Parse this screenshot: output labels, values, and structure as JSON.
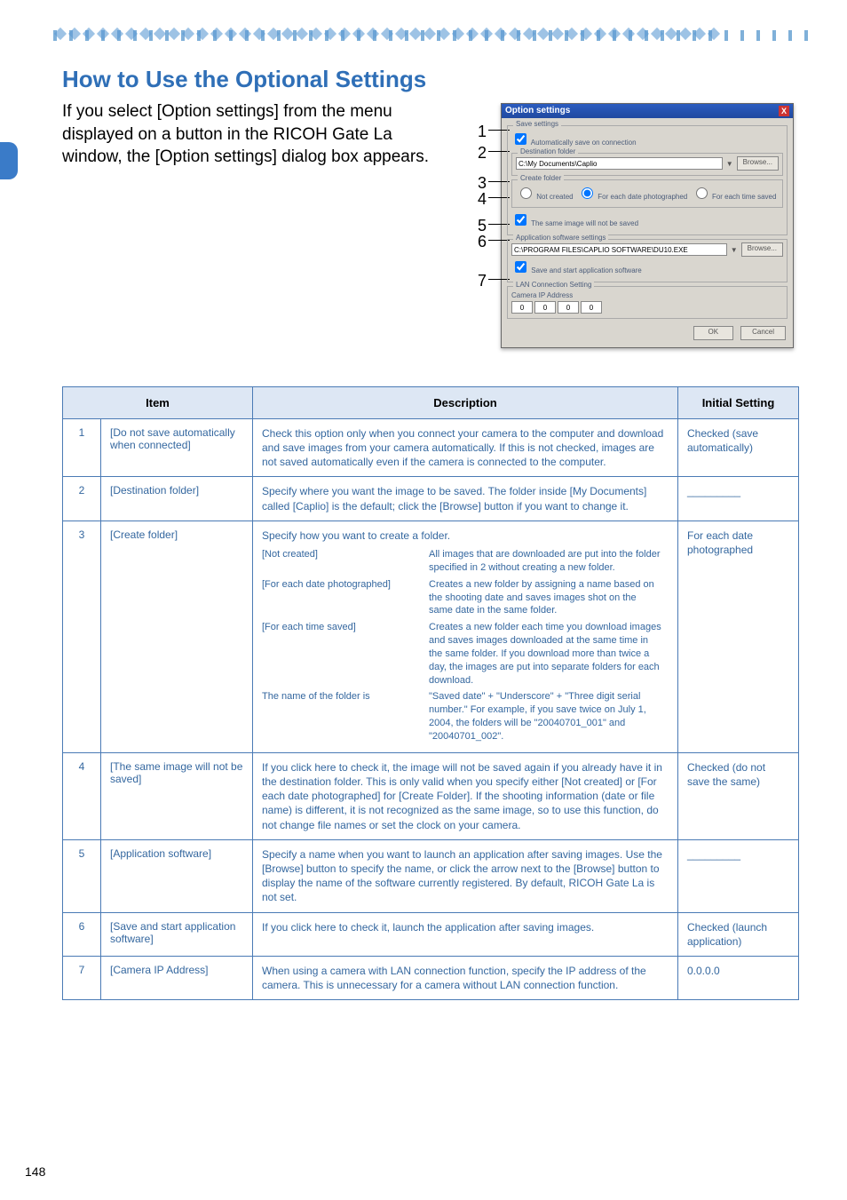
{
  "page_number": "148",
  "heading": "How to Use the Optional Settings",
  "intro": "If you select [Option settings] from the menu displayed on a button in the RICOH Gate La window, the [Option settings] dialog box appears.",
  "callouts": [
    "1",
    "2",
    "3",
    "4",
    "5",
    "6",
    "7"
  ],
  "dialog": {
    "title": "Option settings",
    "close": "X",
    "save_settings_label": "Save settings",
    "auto_save": "Automatically save on connection",
    "destination_label": "Destination folder",
    "destination_value": "C:\\My Documents\\Caplio",
    "browse": "Browse...",
    "create_folder_label": "Create folder",
    "cf_not_created": "Not created",
    "cf_each_date": "For each date photographed",
    "cf_each_time": "For each time saved",
    "same_image_not_saved": "The same image will not be saved",
    "app_settings_label": "Application software settings",
    "app_value": "C:\\PROGRAM FILES\\CAPLIO SOFTWARE\\DU10.EXE",
    "save_and_start": "Save and start application software",
    "lan_label": "LAN Connection Setting",
    "camera_ip_label": "Camera IP Address",
    "ip": [
      "0",
      "0",
      "0",
      "0"
    ],
    "ok": "OK",
    "cancel": "Cancel"
  },
  "table": {
    "head_item": "Item",
    "head_desc": "Description",
    "head_init": "Initial Setting",
    "rows": [
      {
        "n": "1",
        "item": "[Do not save automatically when connected]",
        "desc": "Check this option only when you connect your camera to the computer and download and save images from your camera automatically. If this is not checked, images are not saved automatically even if the camera is connected to the computer.",
        "init": "Checked (save automatically)"
      },
      {
        "n": "2",
        "item": "[Destination folder]",
        "desc": "Specify where you want the image to be saved. The folder inside [My Documents] called [Caplio] is the default; click the [Browse] button if you want to change it.",
        "init": "_________"
      },
      {
        "n": "3",
        "item": "[Create folder]",
        "desc_intro": "Specify how you want to create a folder.",
        "subrows": [
          {
            "k": "[Not created]",
            "v": "All images that are downloaded are put into the folder specified in 2 without creating a new folder."
          },
          {
            "k": "[For each date photographed]",
            "v": "Creates a new folder by assigning a name based on the shooting date and saves images shot on the same date in the same folder."
          },
          {
            "k": "[For each time saved]",
            "v": "Creates a new folder each time you download images and saves images downloaded at the same time in the same folder. If you download more than twice a day, the images are put into separate folders for each download."
          },
          {
            "k": "The name of the folder is",
            "v": "\"Saved date\" + \"Underscore\" + \"Three digit serial number.\" For example, if you save twice on July 1, 2004, the folders will be \"20040701_001\" and \"20040701_002\"."
          }
        ],
        "init": "For each date photographed"
      },
      {
        "n": "4",
        "item": "[The same image will not be saved]",
        "desc": "If you click here to check it, the image will not be saved again if you already have it in the destination folder. This is only valid when you specify either [Not created] or [For each date photographed] for [Create Folder]. If the shooting information (date or file name) is different, it is not recognized as the same image, so to use this function, do not change file names or set the clock on your camera.",
        "init": "Checked (do not save the same)"
      },
      {
        "n": "5",
        "item": "[Application software]",
        "desc": "Specify a name when you want to launch an application after saving images. Use the [Browse] button to specify the name, or click the arrow next to the [Browse] button to display the name of the software currently registered. By default, RICOH Gate La is not set.",
        "init": "_________"
      },
      {
        "n": "6",
        "item": "[Save and start application software]",
        "desc": "If you click here to check it, launch the application after saving images.",
        "init": "Checked (launch application)"
      },
      {
        "n": "7",
        "item": "[Camera IP Address]",
        "desc": "When using a camera with LAN connection function, specify the IP address of the camera. This is unnecessary for a camera without LAN connection function.",
        "init": "0.0.0.0"
      }
    ]
  }
}
